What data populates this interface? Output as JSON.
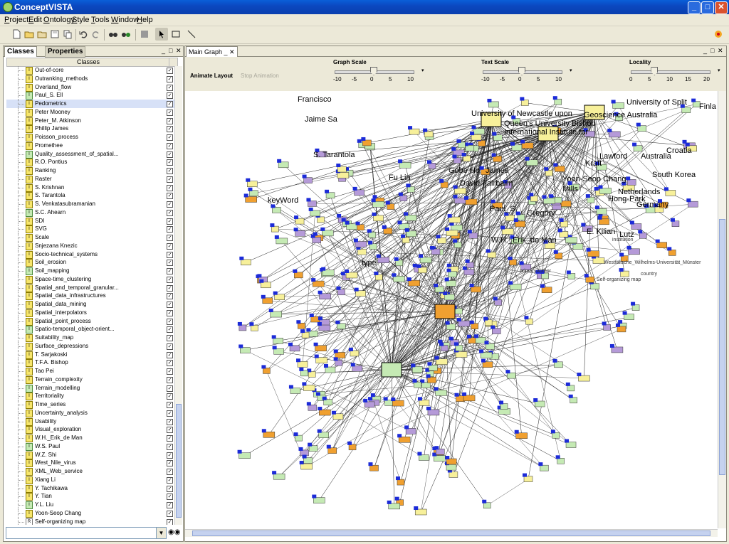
{
  "window": {
    "title": "ConceptVISTA",
    "minimize": "_",
    "maximize": "□",
    "close": "✕"
  },
  "menu": [
    "Project",
    "Edit",
    "Ontology",
    "Style",
    "Tools",
    "Window",
    "Help"
  ],
  "left_panel": {
    "tabs": [
      "Classes",
      "Properties"
    ],
    "column_header": "Classes",
    "items": [
      {
        "label": "Out-of-core",
        "icon": "I",
        "selected": false
      },
      {
        "label": "Outranking_methods",
        "icon": "I",
        "selected": false
      },
      {
        "label": "Overland_flow",
        "icon": "I",
        "selected": false
      },
      {
        "label": "Paul_S. Ell",
        "icon": "I",
        "selected": false
      },
      {
        "label": "Pedometrics",
        "icon": "I",
        "selected": true
      },
      {
        "label": "Peter Mooney",
        "icon": "I",
        "selected": false
      },
      {
        "label": "Peter_M. Atkinson",
        "icon": "I",
        "selected": false
      },
      {
        "label": "Phillip James",
        "icon": "I",
        "selected": false
      },
      {
        "label": "Poisson_process",
        "icon": "I",
        "selected": false
      },
      {
        "label": "Promethee",
        "icon": "I",
        "selected": false
      },
      {
        "label": "Quality_assessment_of_spatial...",
        "icon": "I",
        "selected": false
      },
      {
        "label": "R.O. Pontius",
        "icon": "I",
        "selected": false
      },
      {
        "label": "Ranking",
        "icon": "I",
        "selected": false
      },
      {
        "label": "Raster",
        "icon": "I",
        "selected": false
      },
      {
        "label": "S. Krishnan",
        "icon": "I",
        "selected": false
      },
      {
        "label": "S. Tarantola",
        "icon": "I",
        "selected": false
      },
      {
        "label": "S. Venkatasubramanian",
        "icon": "I",
        "selected": false
      },
      {
        "label": "S.C. Ahearn",
        "icon": "I",
        "selected": false
      },
      {
        "label": "SDI",
        "icon": "I",
        "selected": false
      },
      {
        "label": "SVG",
        "icon": "I",
        "selected": false
      },
      {
        "label": "Scale",
        "icon": "I",
        "selected": false
      },
      {
        "label": "Snjezana Knezic",
        "icon": "I",
        "selected": false
      },
      {
        "label": "Socio-technical_systems",
        "icon": "I",
        "selected": false
      },
      {
        "label": "Soil_erosion",
        "icon": "I",
        "selected": false
      },
      {
        "label": "Soil_mapping",
        "icon": "I",
        "selected": false
      },
      {
        "label": "Space-time_clustering",
        "icon": "I",
        "selected": false
      },
      {
        "label": "Spatial_and_temporal_granular...",
        "icon": "I",
        "selected": false
      },
      {
        "label": "Spatial_data_infrastructures",
        "icon": "I",
        "selected": false
      },
      {
        "label": "Spatial_data_mining",
        "icon": "I",
        "selected": false
      },
      {
        "label": "Spatial_interpolators",
        "icon": "I",
        "selected": false
      },
      {
        "label": "Spatial_point_process",
        "icon": "I",
        "selected": false
      },
      {
        "label": "Spatio-temporal_object-orient...",
        "icon": "I",
        "selected": false
      },
      {
        "label": "Suitability_map",
        "icon": "I",
        "selected": false
      },
      {
        "label": "Surface_depressions",
        "icon": "I",
        "selected": false
      },
      {
        "label": "T. Sarjakoski",
        "icon": "I",
        "selected": false
      },
      {
        "label": "T.F.A. Bishop",
        "icon": "I",
        "selected": false
      },
      {
        "label": "Tao Pei",
        "icon": "I",
        "selected": false
      },
      {
        "label": "Terrain_complexity",
        "icon": "I",
        "selected": false
      },
      {
        "label": "Terrain_modelling",
        "icon": "I",
        "selected": false
      },
      {
        "label": "Territoriality",
        "icon": "I",
        "selected": false
      },
      {
        "label": "Time_series",
        "icon": "I",
        "selected": false
      },
      {
        "label": "Uncertainty_analysis",
        "icon": "I",
        "selected": false
      },
      {
        "label": "Usability",
        "icon": "I",
        "selected": false
      },
      {
        "label": "Visual_exploration",
        "icon": "I",
        "selected": false
      },
      {
        "label": "W.H._Erik_de Man",
        "icon": "I",
        "selected": false
      },
      {
        "label": "W.S. Paul",
        "icon": "I",
        "selected": false
      },
      {
        "label": "W.Z. Shi",
        "icon": "I",
        "selected": false
      },
      {
        "label": "West_Nile_virus",
        "icon": "I",
        "selected": false
      },
      {
        "label": "XML_Web_service",
        "icon": "I",
        "selected": false
      },
      {
        "label": "Xiang Li",
        "icon": "I",
        "selected": false
      },
      {
        "label": "Y. Tachikawa",
        "icon": "I",
        "selected": false
      },
      {
        "label": "Y. Tian",
        "icon": "I",
        "selected": false
      },
      {
        "label": "Y.L. Liu",
        "icon": "I",
        "selected": false
      },
      {
        "label": "Yoon-Seop Chang",
        "icon": "I",
        "selected": false
      },
      {
        "label": "Self-organizing map",
        "icon": "R",
        "selected": false
      }
    ],
    "search_value": ""
  },
  "main_panel": {
    "tab": "Main Graph",
    "animate_layout": "Animate Layout",
    "stop_animation": "Stop Animation",
    "sliders": [
      {
        "title": "Graph Scale",
        "ticks": [
          "-10",
          "-5",
          "0",
          "5",
          "10"
        ],
        "value": 0
      },
      {
        "title": "Text Scale",
        "ticks": [
          "-10",
          "-5",
          "0",
          "5",
          "10"
        ],
        "value": 0
      },
      {
        "title": "Locality",
        "ticks": [
          "0",
          "5",
          "10",
          "15",
          "20"
        ],
        "value": 6
      }
    ],
    "graph_labels": [
      "Francisco",
      "University of Newcastle upon",
      "Queen's University Bishop",
      "Geoscience Australia",
      "University of Split",
      "Finla",
      "Jaime Sa",
      "International Institute for",
      "S. Tarantola",
      "Croatia",
      "Australia",
      "South Korea",
      "Gobe Ho",
      "James",
      "David Fairbairn",
      "Mills",
      "Yoon-Seop Chang",
      "Hong-Park",
      "Netherlands",
      "Germany",
      "Paul_S",
      "Gregory",
      "W.H._Erik_de Man",
      "E. Kilian",
      "Lutz",
      "Westfälische_Wilhelms-Universität_Münster",
      "Self-organizing map",
      "keyWord",
      "type",
      "primaryAuthor",
      "country",
      "institution",
      "Fu Lin",
      "Kraft",
      "Lawford"
    ]
  },
  "colors": {
    "title_bar": "#0a5fd8",
    "chrome": "#ece9d8",
    "node_green": "#c5eab4",
    "node_orange": "#f0a030",
    "node_blue": "#1c2bd8",
    "node_yellow": "#f7f09a",
    "node_purple": "#b59ad8",
    "selection": "#d7e1f7"
  }
}
